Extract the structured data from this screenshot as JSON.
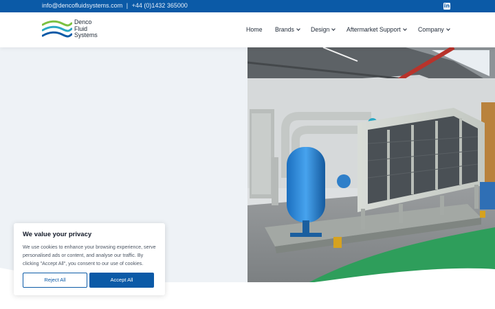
{
  "topbar": {
    "email": "info@dencofluidsystems.com",
    "separator": "|",
    "phone": "+44 (0)1432 365000",
    "social_icon": "linkedin-icon"
  },
  "logo": {
    "line1": "Denco",
    "line2": "Fluid",
    "line3": "Systems"
  },
  "nav": {
    "items": [
      {
        "label": "Home",
        "has_dropdown": false
      },
      {
        "label": "Brands",
        "has_dropdown": true
      },
      {
        "label": "Design",
        "has_dropdown": true
      },
      {
        "label": "Aftermarket Support",
        "has_dropdown": true
      },
      {
        "label": "Company",
        "has_dropdown": true
      }
    ]
  },
  "hero": {
    "image": "industrial-dry-cooler-with-blue-expansion-tank-photo"
  },
  "cookie": {
    "title": "We value your privacy",
    "body": "We use cookies to enhance your browsing experience, serve personalised ads or content, and analyse our traffic. By clicking \"Accept All\", you consent to our use of cookies.",
    "reject_label": "Reject All",
    "accept_label": "Accept All"
  },
  "colors": {
    "brand_blue": "#0b5aa7",
    "logo_green": "#7cc142",
    "logo_teal": "#2aa8c4",
    "floor_green": "#2e9e5b"
  }
}
